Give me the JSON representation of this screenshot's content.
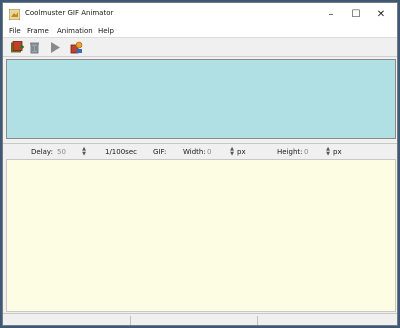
{
  "window": {
    "title": "Coolmuster GIF Animator"
  },
  "window_controls": {
    "minimize": "–",
    "maximize": "☐",
    "close": "✕"
  },
  "menu": {
    "file": "File",
    "frame": "Frame",
    "animation": "Animation",
    "help": "Help"
  },
  "toolbar": {
    "buttons": [
      {
        "icon": "add-images-icon"
      },
      {
        "icon": "delete-icon"
      },
      {
        "icon": "play-icon"
      },
      {
        "icon": "export-icon"
      }
    ]
  },
  "properties": {
    "delay_label": "Delay:",
    "delay_value": "50",
    "delay_unit": "1/100sec",
    "gif_label": "GIF:",
    "width_label": "Width:",
    "width_value": "0",
    "width_unit": "px",
    "height_label": "Height:",
    "height_value": "0",
    "height_unit": "px"
  },
  "colors": {
    "preview_bg": "#b0e0e4",
    "frames_bg": "#fdfde3",
    "chrome_bg": "#f0f0f0"
  }
}
